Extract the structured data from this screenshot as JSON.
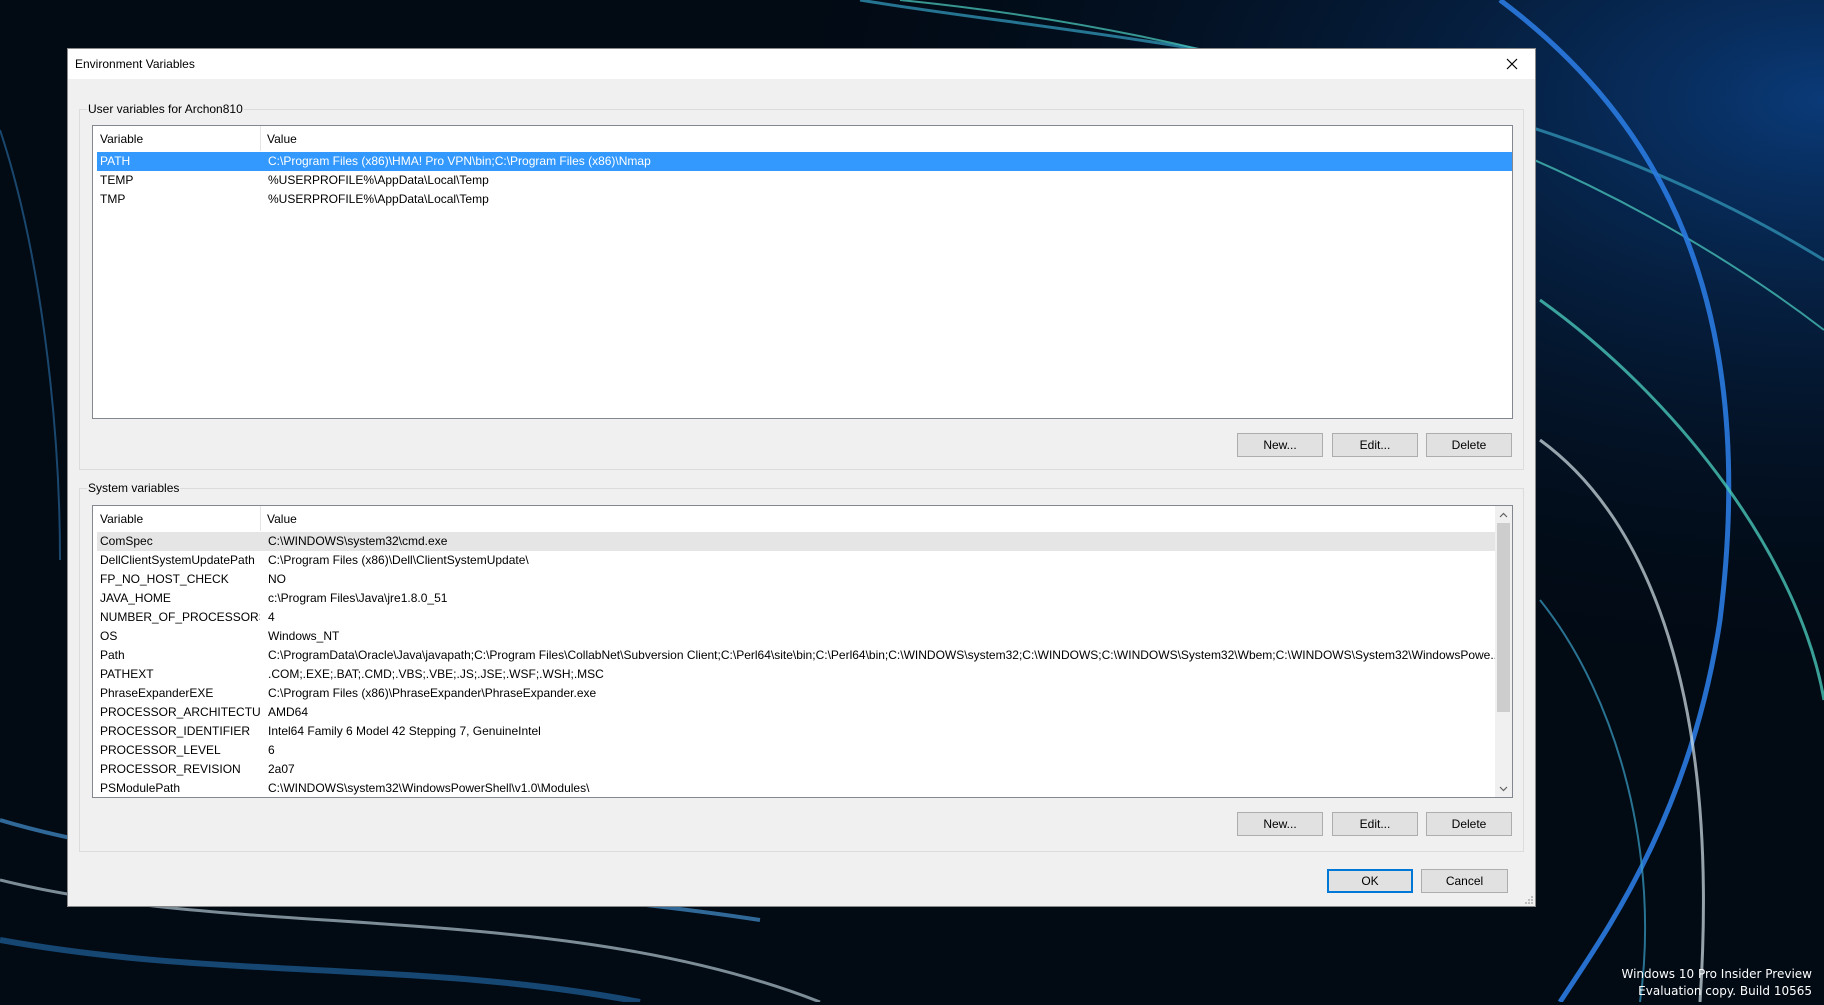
{
  "desktop": {
    "watermark_line1": "Windows 10 Pro Insider Preview",
    "watermark_line2": "Evaluation copy. Build 10565"
  },
  "dialog": {
    "title": "Environment Variables",
    "close_icon": "close-icon"
  },
  "user_vars": {
    "group_label": "User variables for Archon810",
    "col_variable": "Variable",
    "col_value": "Value",
    "rows": [
      {
        "name": "PATH",
        "value": "C:\\Program Files (x86)\\HMA! Pro VPN\\bin;C:\\Program Files (x86)\\Nmap"
      },
      {
        "name": "TEMP",
        "value": "%USERPROFILE%\\AppData\\Local\\Temp"
      },
      {
        "name": "TMP",
        "value": "%USERPROFILE%\\AppData\\Local\\Temp"
      }
    ],
    "new_label": "New...",
    "edit_label": "Edit...",
    "delete_label": "Delete"
  },
  "system_vars": {
    "group_label": "System variables",
    "col_variable": "Variable",
    "col_value": "Value",
    "rows": [
      {
        "name": "ComSpec",
        "value": "C:\\WINDOWS\\system32\\cmd.exe"
      },
      {
        "name": "DellClientSystemUpdatePath",
        "value": "C:\\Program Files (x86)\\Dell\\ClientSystemUpdate\\"
      },
      {
        "name": "FP_NO_HOST_CHECK",
        "value": "NO"
      },
      {
        "name": "JAVA_HOME",
        "value": "c:\\Program Files\\Java\\jre1.8.0_51"
      },
      {
        "name": "NUMBER_OF_PROCESSORS",
        "value": "4"
      },
      {
        "name": "OS",
        "value": "Windows_NT"
      },
      {
        "name": "Path",
        "value": "C:\\ProgramData\\Oracle\\Java\\javapath;C:\\Program Files\\CollabNet\\Subversion Client;C:\\Perl64\\site\\bin;C:\\Perl64\\bin;C:\\WINDOWS\\system32;C:\\WINDOWS;C:\\WINDOWS\\System32\\Wbem;C:\\WINDOWS\\System32\\WindowsPowe..."
      },
      {
        "name": "PATHEXT",
        "value": ".COM;.EXE;.BAT;.CMD;.VBS;.VBE;.JS;.JSE;.WSF;.WSH;.MSC"
      },
      {
        "name": "PhraseExpanderEXE",
        "value": "C:\\Program Files (x86)\\PhraseExpander\\PhraseExpander.exe"
      },
      {
        "name": "PROCESSOR_ARCHITECTURE",
        "value": "AMD64"
      },
      {
        "name": "PROCESSOR_IDENTIFIER",
        "value": "Intel64 Family 6 Model 42 Stepping 7, GenuineIntel"
      },
      {
        "name": "PROCESSOR_LEVEL",
        "value": "6"
      },
      {
        "name": "PROCESSOR_REVISION",
        "value": "2a07"
      },
      {
        "name": "PSModulePath",
        "value": "C:\\WINDOWS\\system32\\WindowsPowerShell\\v1.0\\Modules\\"
      }
    ],
    "new_label": "New...",
    "edit_label": "Edit...",
    "delete_label": "Delete"
  },
  "footer": {
    "ok_label": "OK",
    "cancel_label": "Cancel"
  },
  "colors": {
    "selection": "#3399ff",
    "default_button_border": "#0078d7",
    "dialog_bg": "#f0f0f0"
  }
}
